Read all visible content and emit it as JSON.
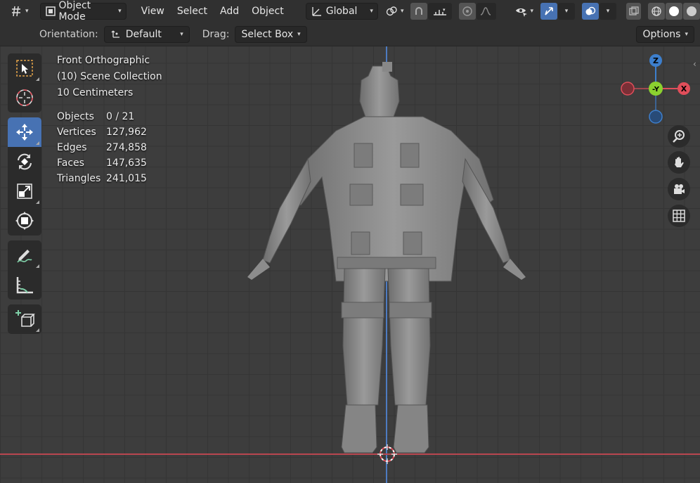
{
  "header": {
    "mode": "Object Mode",
    "menus": [
      "View",
      "Select",
      "Add",
      "Object"
    ],
    "transform_orientation": "Global"
  },
  "subheader": {
    "orientation_label": "Orientation:",
    "orientation_value": "Default",
    "drag_label": "Drag:",
    "drag_value": "Select Box",
    "options_label": "Options"
  },
  "overlay": {
    "view_name": "Front Orthographic",
    "collection": "(10) Scene Collection",
    "grid_scale": "10 Centimeters",
    "stats": [
      {
        "key": "Objects",
        "value": "0 / 21"
      },
      {
        "key": "Vertices",
        "value": "127,962"
      },
      {
        "key": "Edges",
        "value": "274,858"
      },
      {
        "key": "Faces",
        "value": "147,635"
      },
      {
        "key": "Triangles",
        "value": "241,015"
      }
    ]
  },
  "gizmo": {
    "z": "Z",
    "y": "-Y",
    "x": "X"
  },
  "colors": {
    "accent": "#4772b3",
    "axis_x": "#e14e5a",
    "axis_y": "#8bd12f",
    "axis_z": "#3d7fcd"
  }
}
